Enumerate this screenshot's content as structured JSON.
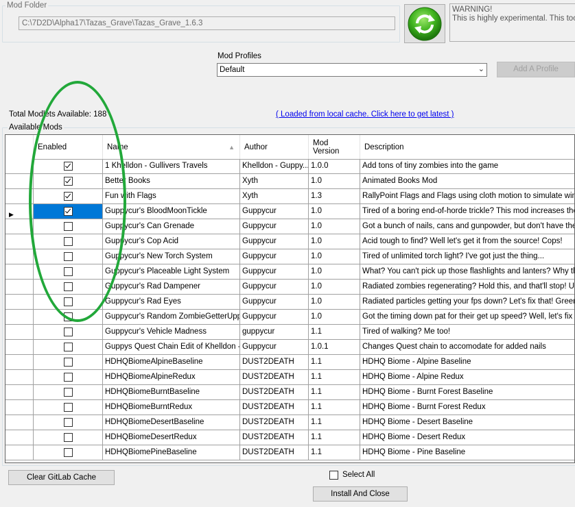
{
  "mod_folder": {
    "label": "Mod Folder",
    "path": "C:\\7D2D\\Alpha17\\Tazas_Grave\\Tazas_Grave_1.6.3"
  },
  "refresh_icon": "refresh-icon",
  "warning_text": "WARNING!\nThis is highly experimental. This tool do",
  "profiles": {
    "label": "Mod Profiles",
    "selected": "Default",
    "add_label": "Add A Profile"
  },
  "totals": {
    "text": "Total Modlets Available: 188",
    "cache_link": "( Loaded from local cache. Click here to get latest )"
  },
  "available_label": "Available Mods",
  "grid": {
    "columns": {
      "enabled": "Enabled",
      "name": "Name",
      "author": "Author",
      "version": "Mod\nVersion",
      "description": "Description"
    },
    "rows": [
      {
        "enabled": true,
        "name": "1 Khelldon - Gullivers Travels",
        "author": "Khelldon - Guppy...",
        "version": "1.0.0",
        "description": "Add tons of tiny zombies into the game"
      },
      {
        "enabled": true,
        "name": "Better Books",
        "author": "Xyth",
        "version": "1.0",
        "description": "Animated Books Mod"
      },
      {
        "enabled": true,
        "name": "Fun with Flags",
        "author": "Xyth",
        "version": "1.3",
        "description": "RallyPoint Flags and Flags using cloth motion to simulate wind effe"
      },
      {
        "enabled": true,
        "name": "Guppycur's BloodMoonTickle",
        "author": "Guppycur",
        "version": "1.0",
        "description": "Tired of a boring end-of-horde trickle? This mod increases the horde"
      },
      {
        "enabled": false,
        "name": "Guppycur's Can Grenade",
        "author": "Guppycur",
        "version": "1.0",
        "description": "Got a bunch of nails, cans and gunpowder, but don't have the skil"
      },
      {
        "enabled": false,
        "name": "Guppycur's Cop Acid",
        "author": "Guppycur",
        "version": "1.0",
        "description": "Acid tough to find?  Well let's get it from the source!  Cops!"
      },
      {
        "enabled": false,
        "name": "Guppycur's New Torch System",
        "author": "Guppycur",
        "version": "1.0",
        "description": "Tired of unlimited torch light?  I've got just the thing..."
      },
      {
        "enabled": false,
        "name": "Guppycur's Placeable Light System",
        "author": "Guppycur",
        "version": "1.0",
        "description": "What?  You can't pick up those flashlights and lanters?  Why the h"
      },
      {
        "enabled": false,
        "name": "Guppycur's Rad Dampener",
        "author": "Guppycur",
        "version": "1.0",
        "description": "Radiated zombies regenerating?  Hold this, and that'll stop!  Until y"
      },
      {
        "enabled": false,
        "name": "Guppycur's Rad Eyes",
        "author": "Guppycur",
        "version": "1.0",
        "description": "Radiated particles getting your fps down?  Let's fix that!  Green glo"
      },
      {
        "enabled": false,
        "name": "Guppycur's Random ZombieGetterUpper",
        "author": "Guppycur",
        "version": "1.0",
        "description": "Got the timing down pat for their get up speed?  Well, let's fix that!"
      },
      {
        "enabled": false,
        "name": "Guppycur's Vehicle Madness",
        "author": "guppycur",
        "version": "1.1",
        "description": "Tired of walking?  Me too!"
      },
      {
        "enabled": false,
        "name": "Guppys Quest Chain Edit of Khelldon - ...",
        "author": "Guppycur",
        "version": "1.0.1",
        "description": "Changes Quest chain to accomodate for added nails"
      },
      {
        "enabled": false,
        "name": "HDHQBiomeAlpineBaseline",
        "author": "DUST2DEATH",
        "version": "1.1",
        "description": "HDHQ Biome - Alpine Baseline"
      },
      {
        "enabled": false,
        "name": "HDHQBiomeAlpineRedux",
        "author": "DUST2DEATH",
        "version": "1.1",
        "description": "HDHQ Biome - Alpine Redux"
      },
      {
        "enabled": false,
        "name": "HDHQBiomeBurntBaseline",
        "author": "DUST2DEATH",
        "version": "1.1",
        "description": "HDHQ Biome - Burnt Forest Baseline"
      },
      {
        "enabled": false,
        "name": "HDHQBiomeBurntRedux",
        "author": "DUST2DEATH",
        "version": "1.1",
        "description": "HDHQ Biome - Burnt Forest Redux"
      },
      {
        "enabled": false,
        "name": "HDHQBiomeDesertBaseline",
        "author": "DUST2DEATH",
        "version": "1.1",
        "description": "HDHQ Biome - Desert Baseline"
      },
      {
        "enabled": false,
        "name": "HDHQBiomeDesertRedux",
        "author": "DUST2DEATH",
        "version": "1.1",
        "description": "HDHQ Biome - Desert Redux"
      },
      {
        "enabled": false,
        "name": "HDHQBiomePineBaseline",
        "author": "DUST2DEATH",
        "version": "1.1",
        "description": "HDHQ Biome - Pine Baseline"
      }
    ]
  },
  "buttons": {
    "clear_cache": "Clear GitLab Cache",
    "select_all": "Select All",
    "install_close": "Install And Close"
  },
  "colors": {
    "selection": "#0078d7",
    "annotation": "#22a83a"
  }
}
